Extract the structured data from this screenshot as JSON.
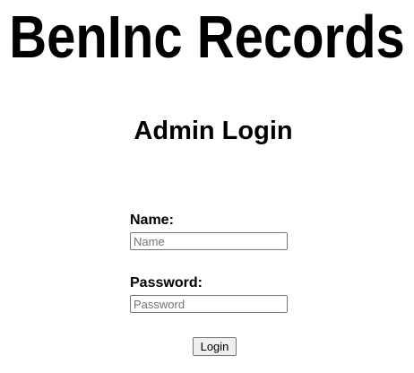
{
  "header": {
    "title": "BenInc Records"
  },
  "login": {
    "heading": "Admin Login",
    "name_label": "Name:",
    "name_placeholder": "Name",
    "password_label": "Password:",
    "password_placeholder": "Password",
    "submit_label": "Login"
  }
}
